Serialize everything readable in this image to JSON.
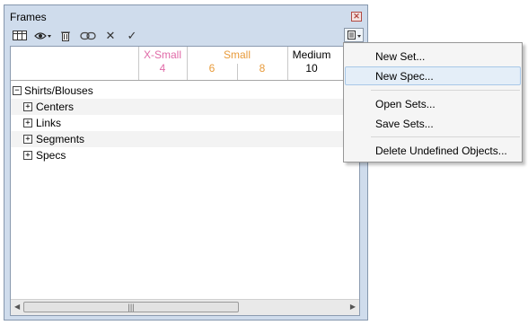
{
  "window": {
    "title": "Frames"
  },
  "toolbar": {
    "icons": [
      "columns-icon",
      "eye-icon",
      "trash-icon",
      "link-icon",
      "delete-x-icon",
      "check-icon",
      "menu-icon"
    ],
    "glyphs": {
      "eye": "👁",
      "x": "✕",
      "check": "✓"
    }
  },
  "columns": [
    {
      "group": "X-Small",
      "sizes": [
        "4"
      ],
      "color": "#e06aa8"
    },
    {
      "group": "Small",
      "sizes": [
        "6",
        "8"
      ],
      "color": "#e89b3b"
    },
    {
      "group": "Medium",
      "sizes": [
        "10"
      ],
      "color": "#000000"
    }
  ],
  "tree": {
    "root": {
      "label": "Shirts/Blouses",
      "toggle": "−"
    },
    "children": [
      {
        "label": "Centers",
        "toggle": "+"
      },
      {
        "label": "Links",
        "toggle": "+"
      },
      {
        "label": "Segments",
        "toggle": "+"
      },
      {
        "label": "Specs",
        "toggle": "+"
      }
    ]
  },
  "scrollbar": {
    "left": "◀",
    "right": "▶",
    "grip": "|||"
  },
  "context_menu": {
    "items": [
      "New Set...",
      "New Spec...",
      "Open Sets...",
      "Save Sets...",
      "Delete Undefined Objects..."
    ],
    "hovered_index": 1
  }
}
